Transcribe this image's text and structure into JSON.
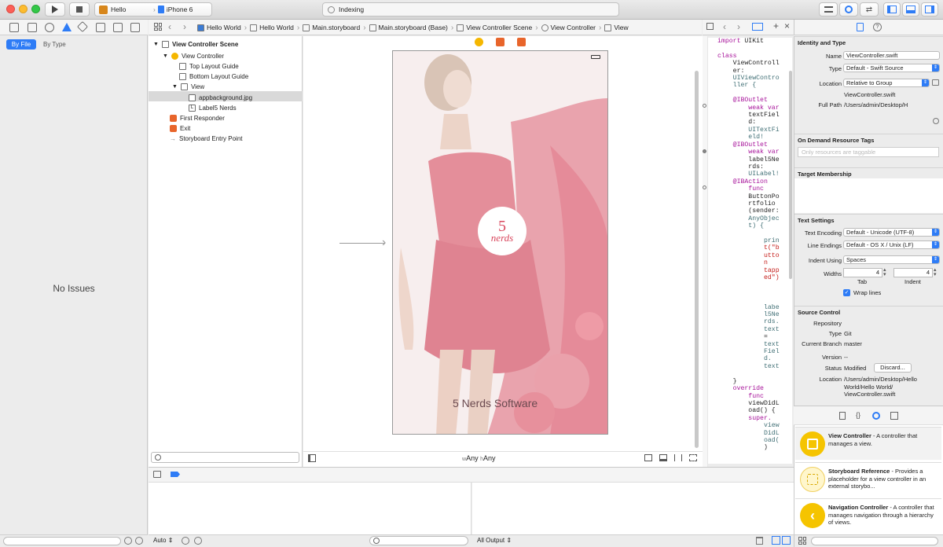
{
  "window": {
    "scheme_app": "Hello",
    "scheme_device": "iPhone 6",
    "activity_text": "Indexing"
  },
  "issues_navigator": {
    "tabs": [
      "By File",
      "By Type"
    ],
    "empty_message": "No Issues"
  },
  "breadcrumbs": [
    "Hello World",
    "Hello World",
    "Main.storyboard",
    "Main.storyboard (Base)",
    "View Controller Scene",
    "View Controller",
    "View"
  ],
  "outline": {
    "scene_title": "View Controller Scene",
    "items": [
      {
        "label": "View Controller"
      },
      {
        "label": "Top Layout Guide"
      },
      {
        "label": "Bottom Layout Guide"
      },
      {
        "label": "View"
      },
      {
        "label": "appbackground.jpg"
      },
      {
        "label": "Label5 Nerds"
      },
      {
        "label": "First Responder"
      },
      {
        "label": "Exit"
      },
      {
        "label": "Storyboard Entry Point"
      }
    ]
  },
  "canvas": {
    "logo_number": "5",
    "logo_word": "nerds",
    "overlay_label": "5 Nerds Software",
    "size_class_w": "w",
    "size_class_w_value": "Any",
    "size_class_h": "h",
    "size_class_h_value": "Any"
  },
  "code_lines": [
    [
      {
        "t": "import",
        "c": "kw"
      },
      {
        "t": " UIKit",
        "c": ""
      }
    ],
    [
      {
        "t": "",
        "c": ""
      }
    ],
    [
      {
        "t": "class",
        "c": "kw"
      }
    ],
    [
      {
        "t": "    ViewControll",
        "c": ""
      }
    ],
    [
      {
        "t": "    er:",
        "c": ""
      }
    ],
    [
      {
        "t": "    UIViewContro",
        "c": "ty"
      }
    ],
    [
      {
        "t": "    ller {",
        "c": "ty"
      }
    ],
    [
      {
        "t": "",
        "c": ""
      }
    ],
    [
      {
        "t": "    @IBOutlet",
        "c": "kw"
      }
    ],
    [
      {
        "t": "        weak var",
        "c": "kw"
      }
    ],
    [
      {
        "t": "        textFiel",
        "c": ""
      }
    ],
    [
      {
        "t": "        d:",
        "c": ""
      }
    ],
    [
      {
        "t": "        UITextFi",
        "c": "ty"
      }
    ],
    [
      {
        "t": "        eld!",
        "c": "ty"
      }
    ],
    [
      {
        "t": "    @IBOutlet",
        "c": "kw"
      }
    ],
    [
      {
        "t": "        weak var",
        "c": "kw"
      }
    ],
    [
      {
        "t": "        label5Ne",
        "c": ""
      }
    ],
    [
      {
        "t": "        rds:",
        "c": ""
      }
    ],
    [
      {
        "t": "        UILabel!",
        "c": "ty"
      }
    ],
    [
      {
        "t": "    @IBAction",
        "c": "kw"
      }
    ],
    [
      {
        "t": "        func",
        "c": "kw"
      }
    ],
    [
      {
        "t": "        ButtonPo",
        "c": ""
      }
    ],
    [
      {
        "t": "        rtfolio",
        "c": ""
      }
    ],
    [
      {
        "t": "        (sender:",
        "c": ""
      }
    ],
    [
      {
        "t": "        AnyObjec",
        "c": "ty"
      }
    ],
    [
      {
        "t": "        t) {",
        "c": "ty"
      }
    ],
    [
      {
        "t": "",
        "c": ""
      }
    ],
    [
      {
        "t": "            prin",
        "c": "ty"
      }
    ],
    [
      {
        "t": "            t(\"b",
        "c": "str"
      }
    ],
    [
      {
        "t": "            utto",
        "c": "str"
      }
    ],
    [
      {
        "t": "            n",
        "c": "str"
      }
    ],
    [
      {
        "t": "            tapp",
        "c": "str"
      }
    ],
    [
      {
        "t": "            ed\")",
        "c": "str"
      }
    ],
    [
      {
        "t": "",
        "c": ""
      }
    ],
    [
      {
        "t": "",
        "c": ""
      }
    ],
    [
      {
        "t": "",
        "c": ""
      }
    ],
    [
      {
        "t": "            labe",
        "c": "ty"
      }
    ],
    [
      {
        "t": "            l5Ne",
        "c": "ty"
      }
    ],
    [
      {
        "t": "            rds.",
        "c": "ty"
      }
    ],
    [
      {
        "t": "            text",
        "c": "ty"
      }
    ],
    [
      {
        "t": "            =",
        "c": ""
      }
    ],
    [
      {
        "t": "            text",
        "c": "ty"
      }
    ],
    [
      {
        "t": "            Fiel",
        "c": "ty"
      }
    ],
    [
      {
        "t": "            d.",
        "c": "ty"
      }
    ],
    [
      {
        "t": "            text",
        "c": "ty"
      }
    ],
    [
      {
        "t": "",
        "c": ""
      }
    ],
    [
      {
        "t": "    }",
        "c": ""
      }
    ],
    [
      {
        "t": "    override",
        "c": "kw"
      }
    ],
    [
      {
        "t": "        func",
        "c": "kw"
      }
    ],
    [
      {
        "t": "        viewDidL",
        "c": ""
      }
    ],
    [
      {
        "t": "        oad() {",
        "c": ""
      }
    ],
    [
      {
        "t": "        super.",
        "c": "kw"
      }
    ],
    [
      {
        "t": "            view",
        "c": "ty"
      }
    ],
    [
      {
        "t": "            DidL",
        "c": "ty"
      }
    ],
    [
      {
        "t": "            oad(",
        "c": "ty"
      }
    ],
    [
      {
        "t": "            )",
        "c": ""
      }
    ]
  ],
  "inspector": {
    "identity_title": "Identity and Type",
    "name_label": "Name",
    "name_value": "ViewController.swift",
    "type_label": "Type",
    "type_value": "Default - Swift Source",
    "location_label": "Location",
    "location_value": "Relative to Group",
    "location_file": "ViewController.swift",
    "fullpath_label": "Full Path",
    "fullpath_value": "/Users/admin/Desktop/H",
    "odr_title": "On Demand Resource Tags",
    "odr_placeholder": "Only resources are taggable",
    "target_title": "Target Membership",
    "text_title": "Text Settings",
    "encoding_label": "Text Encoding",
    "encoding_value": "Default - Unicode (UTF-8)",
    "line_endings_label": "Line Endings",
    "line_endings_value": "Default - OS X / Unix (LF)",
    "indent_label": "Indent Using",
    "indent_value": "Spaces",
    "widths_label": "Widths",
    "tab_value": "4",
    "indent_width_value": "4",
    "tab_caption": "Tab",
    "indent_caption": "Indent",
    "wrap_label": "Wrap lines",
    "sc_title": "Source Control",
    "repo_label": "Repository",
    "sc_type_label": "Type",
    "sc_type_value": "Git",
    "branch_label": "Current Branch",
    "branch_value": "master",
    "version_label": "Version",
    "version_value": "--",
    "status_label": "Status",
    "status_value": "Modified",
    "discard_label": "Discard...",
    "sc_location_label": "Location",
    "sc_location_value": "/Users/admin/Desktop/Hello World/Hello World/ ViewController.swift"
  },
  "library": [
    {
      "title": "View Controller",
      "desc": " - A controller that manages a view.",
      "color": "#f5c400"
    },
    {
      "title": "Storyboard Reference",
      "desc": " - Provides a placeholder for a view controller in an external storybo...",
      "color": "#fff6cc"
    },
    {
      "title": "Navigation Controller",
      "desc": " - A controller that manages navigation through a hierarchy of views.",
      "color": "#f5c400"
    }
  ],
  "debug": {
    "auto_label": "Auto",
    "output_label": "All Output"
  }
}
